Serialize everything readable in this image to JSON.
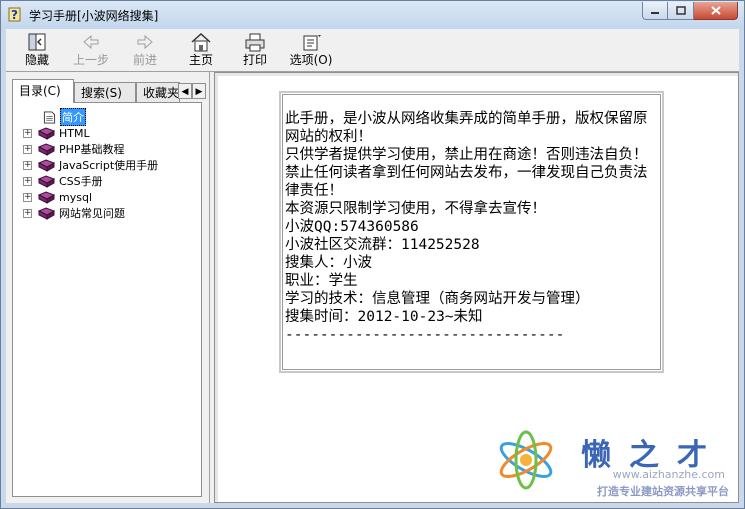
{
  "window": {
    "title": "学习手册[小波网络搜集]"
  },
  "toolbar": {
    "hide": "隐藏",
    "back": "上一步",
    "forward": "前进",
    "home": "主页",
    "print": "打印",
    "options": "选项(O)"
  },
  "tabs": {
    "contents": "目录(C)",
    "search": "搜索(S)",
    "favorites": "收藏夹"
  },
  "tree": {
    "intro": "简介",
    "items": [
      "HTML",
      "PHP基础教程",
      "JavaScript使用手册",
      "CSS手册",
      "mysql",
      "网站常见问题"
    ]
  },
  "content": {
    "para1": "此手册，是小波从网络收集弄成的简单手册，版权保留原网站的权利！",
    "para2": "只供学者提供学习使用，禁止用在商途！否则违法自负！",
    "para3": "禁止任何读者拿到任何网站去发布，一律发现自己负责法律责任！",
    "para4": "本资源只限制学习使用，不得拿去宣传！",
    "qq": "小波QQ:574360586",
    "group": "小波社区交流群：114252528",
    "collector": "搜集人：小波",
    "job": "职业：学生",
    "skill": "学习的技术：信息管理（商务网站开发与管理）",
    "time": "搜集时间：2012-10-23~未知",
    "rule": "--------------------------------"
  },
  "watermark": {
    "brand": "懒之才",
    "url": "www.aizhanzhe.com",
    "slogan": "打造专业建站资源共享平台"
  },
  "colors": {
    "selection": "#3399ff",
    "book": "#7a2a6e"
  }
}
